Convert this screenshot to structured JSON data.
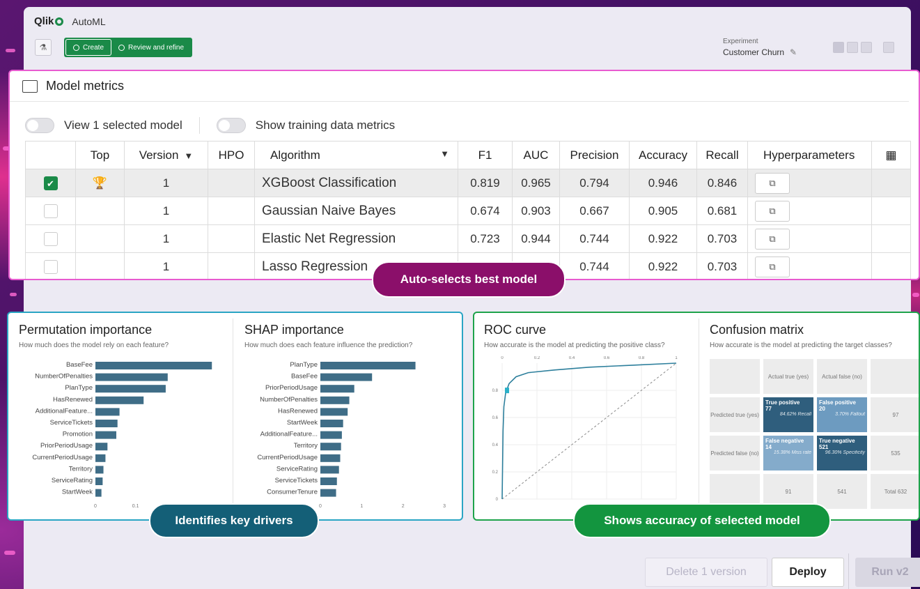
{
  "app": {
    "brand": "Qlik",
    "product": "AutoML"
  },
  "stepper": {
    "step1": "Create",
    "step2": "Review and refine"
  },
  "experiment": {
    "label": "Experiment",
    "name": "Customer Churn"
  },
  "metrics": {
    "title": "Model metrics",
    "toggle1": "View 1 selected model",
    "toggle2": "Show training data metrics",
    "columns": [
      "Top",
      "Version",
      "HPO",
      "Algorithm",
      "F1",
      "AUC",
      "Precision",
      "Accuracy",
      "Recall",
      "Hyperparameters"
    ],
    "rows": [
      {
        "version": "1",
        "algorithm": "XGBoost Classification",
        "f1": "0.819",
        "auc": "0.965",
        "precision": "0.794",
        "accuracy": "0.946",
        "recall": "0.846"
      },
      {
        "version": "1",
        "algorithm": "Gaussian Naive Bayes",
        "f1": "0.674",
        "auc": "0.903",
        "precision": "0.667",
        "accuracy": "0.905",
        "recall": "0.681"
      },
      {
        "version": "1",
        "algorithm": "Elastic Net Regression",
        "f1": "0.723",
        "auc": "0.944",
        "precision": "0.744",
        "accuracy": "0.922",
        "recall": "0.703"
      },
      {
        "version": "1",
        "algorithm": "Lasso Regression",
        "f1": "",
        "auc": "",
        "precision": "0.744",
        "accuracy": "0.922",
        "recall": "0.703"
      }
    ]
  },
  "pills": {
    "best": "Auto-selects best model",
    "drivers": "Identifies key drivers",
    "accuracy": "Shows accuracy of selected model"
  },
  "permutation": {
    "title": "Permutation importance",
    "subtitle": "How much does the model rely on each feature?",
    "features": [
      "BaseFee",
      "NumberOfPenalties",
      "PlanType",
      "HasRenewed",
      "AdditionalFeature...",
      "ServiceTickets",
      "Promotion",
      "PriorPeriodUsage",
      "CurrentPeriodUsage",
      "Territory",
      "ServiceRating",
      "StartWeek"
    ],
    "values": [
      0.29,
      0.18,
      0.175,
      0.12,
      0.06,
      0.055,
      0.052,
      0.03,
      0.025,
      0.02,
      0.018,
      0.015
    ],
    "ticks": [
      "0",
      "0.1"
    ]
  },
  "shap": {
    "title": "SHAP importance",
    "subtitle": "How much does each feature influence the prediction?",
    "features": [
      "PlanType",
      "BaseFee",
      "PriorPeriodUsage",
      "NumberOfPenalties",
      "HasRenewed",
      "StartWeek",
      "AdditionalFeature...",
      "Territory",
      "CurrentPeriodUsage",
      "ServiceRating",
      "ServiceTickets",
      "ConsumerTenure"
    ],
    "values": [
      2.3,
      1.25,
      0.82,
      0.7,
      0.66,
      0.55,
      0.52,
      0.5,
      0.48,
      0.45,
      0.4,
      0.38
    ],
    "ticks": [
      "0",
      "1",
      "2",
      "3"
    ]
  },
  "roc": {
    "title": "ROC curve",
    "subtitle": "How accurate is the model at predicting the positive class?",
    "xticks": [
      "0",
      "0.2",
      "0.4",
      "0.6",
      "0.8",
      "1"
    ],
    "yticks": [
      "0",
      "0.2",
      "0.4",
      "0.6",
      "0.8"
    ]
  },
  "confusion": {
    "title": "Confusion matrix",
    "subtitle": "How accurate is the model at predicting the target classes?",
    "actual_true": "Actual true (yes)",
    "actual_false": "Actual false (no)",
    "pred_true": "Predicted true (yes)",
    "pred_false": "Predicted false (no)",
    "tp_label": "True positive",
    "tp": "77",
    "tp_pct": "84.62%",
    "tp_metric": "Recall",
    "fp_label": "False positive",
    "fp": "20",
    "fp_pct": "3.70%",
    "fp_metric": "Fallout",
    "fn_label": "False negative",
    "fn": "14",
    "fn_pct": "15.38%",
    "fn_metric": "Miss rate",
    "tn_label": "True negative",
    "tn": "521",
    "tn_pct": "96.30%",
    "tn_metric": "Specificity",
    "row1_total": "97",
    "row2_total": "535",
    "col1_total": "91",
    "col2_total": "541",
    "total": "Total 632"
  },
  "buttons": {
    "delete": "Delete 1 version",
    "deploy": "Deploy",
    "run": "Run v2"
  }
}
